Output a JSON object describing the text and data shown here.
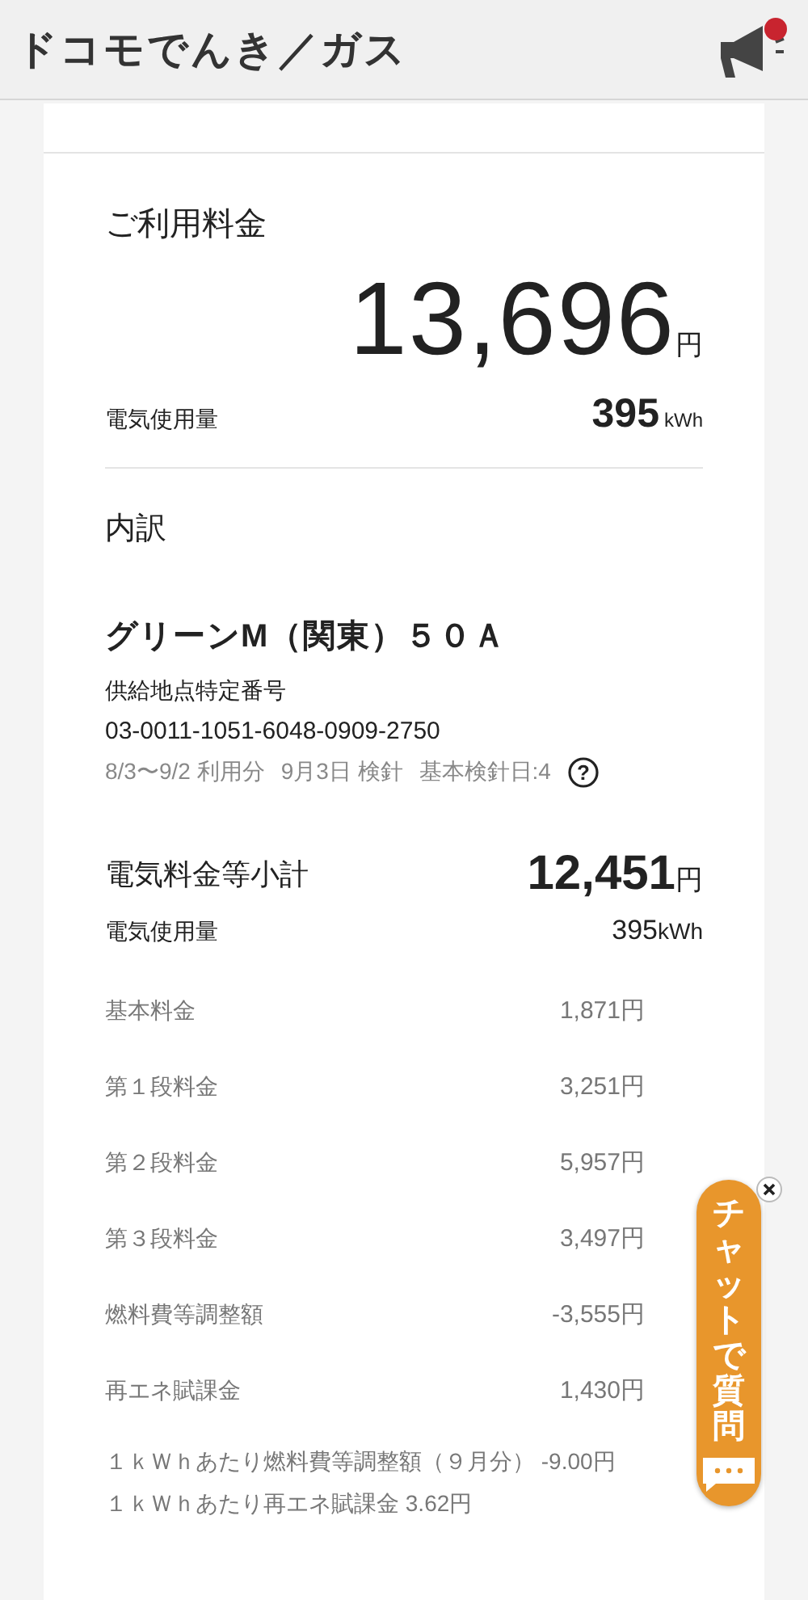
{
  "header": {
    "logo": "ドコモでんき／ガス"
  },
  "summary": {
    "title": "ご利用料金",
    "amount": "13,696",
    "amount_unit": "円",
    "usage_label": "電気使用量",
    "usage_value": "395",
    "usage_unit": "kWh"
  },
  "breakdown": {
    "title": "内訳",
    "plan": "グリーンM（関東）５０Ａ",
    "supply_label": "供給地点特定番号",
    "supply_number": "03-0011-1051-6048-0909-2750",
    "period": "8/3〜9/2 利用分",
    "meter_date": "9月3日 検針",
    "base_day": "基本検針日:4",
    "help_mark": "?"
  },
  "subtotal": {
    "label": "電気料金等小計",
    "value": "12,451",
    "unit": "円",
    "usage_label": "電気使用量",
    "usage_value": "395",
    "usage_unit": "kWh"
  },
  "items": [
    {
      "label": "基本料金",
      "value": "1,871円"
    },
    {
      "label": "第１段料金",
      "value": "3,251円"
    },
    {
      "label": "第２段料金",
      "value": "5,957円"
    },
    {
      "label": "第３段料金",
      "value": "3,497円"
    },
    {
      "label": "燃料費等調整額",
      "value": "-3,555円"
    },
    {
      "label": "再エネ賦課金",
      "value": "1,430円"
    }
  ],
  "notes": [
    "１ｋＷｈあたり燃料費等調整額（９月分） -9.00円",
    "１ｋＷｈあたり再エネ賦課金 3.62円"
  ],
  "chat": {
    "label": "チャットで質問"
  }
}
